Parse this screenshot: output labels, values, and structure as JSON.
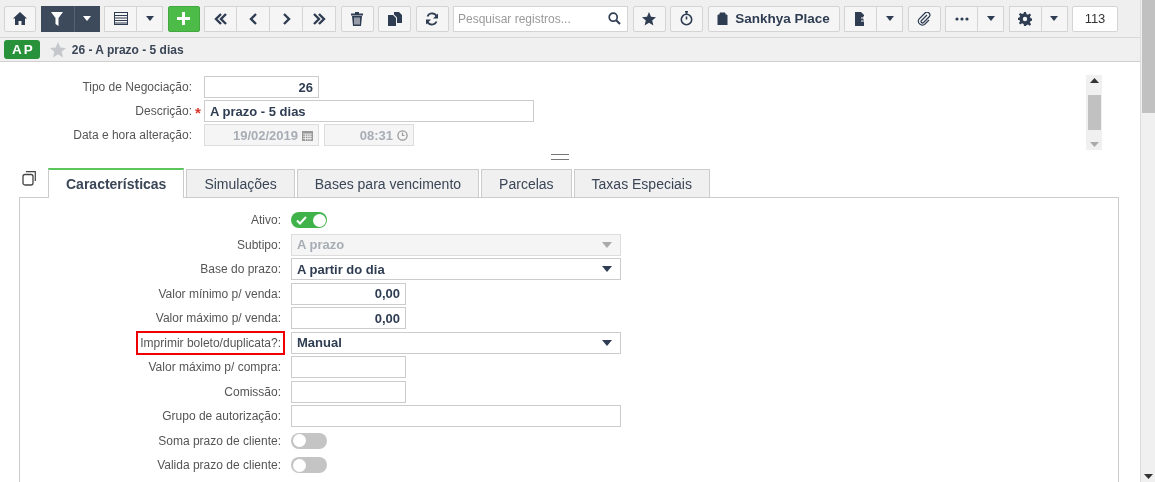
{
  "toolbar": {
    "search": {
      "placeholder": "Pesquisar registros..."
    },
    "place_button": "Sankhya Place",
    "record_count": "113"
  },
  "record": {
    "badge": "AP",
    "title": "26 - A prazo - 5 dias",
    "favorite": false
  },
  "header_fields": [
    {
      "label": "Tipo de Negociação:",
      "kind": "number",
      "value": "26"
    },
    {
      "label": "Descrição:",
      "kind": "text",
      "value": "A prazo - 5 dias",
      "required_mark": "*"
    },
    {
      "label": "Data e hora alteração:",
      "kind": "datetime",
      "date": "19/02/2019",
      "time": "08:31",
      "disabled": true
    }
  ],
  "tabs": [
    {
      "label": "Características",
      "selected": true
    },
    {
      "label": "Simulações",
      "selected": false
    },
    {
      "label": "Bases para vencimento",
      "selected": false
    },
    {
      "label": "Parcelas",
      "selected": false
    },
    {
      "label": "Taxas Especiais",
      "selected": false
    }
  ],
  "fields": [
    {
      "label": "Ativo:",
      "kind": "toggle",
      "on": true,
      "highlighted": false
    },
    {
      "label": "Subtipo:",
      "kind": "select",
      "value": "A prazo",
      "disabled": true,
      "highlighted": false
    },
    {
      "label": "Base do prazo:",
      "kind": "select",
      "value": "A partir do dia",
      "disabled": false,
      "highlighted": false
    },
    {
      "label": "Valor mínimo p/ venda:",
      "kind": "number",
      "value": "0,00",
      "highlighted": false
    },
    {
      "label": "Valor máximo p/ venda:",
      "kind": "number",
      "value": "0,00",
      "highlighted": false
    },
    {
      "label": "Imprimir boleto/duplicata?:",
      "kind": "select",
      "value": "Manual",
      "disabled": false,
      "highlighted": true
    },
    {
      "label": "Valor máximo p/ compra:",
      "kind": "number",
      "highlighted": false
    },
    {
      "label": "Comissão:",
      "kind": "number",
      "highlighted": false
    },
    {
      "label": "Grupo de autorização:",
      "kind": "text",
      "highlighted": false
    },
    {
      "label": "Soma prazo de cliente:",
      "kind": "toggle",
      "on": false,
      "highlighted": false
    },
    {
      "label": "Valida prazo de cliente:",
      "kind": "toggle",
      "on": false,
      "highlighted": false
    }
  ]
}
